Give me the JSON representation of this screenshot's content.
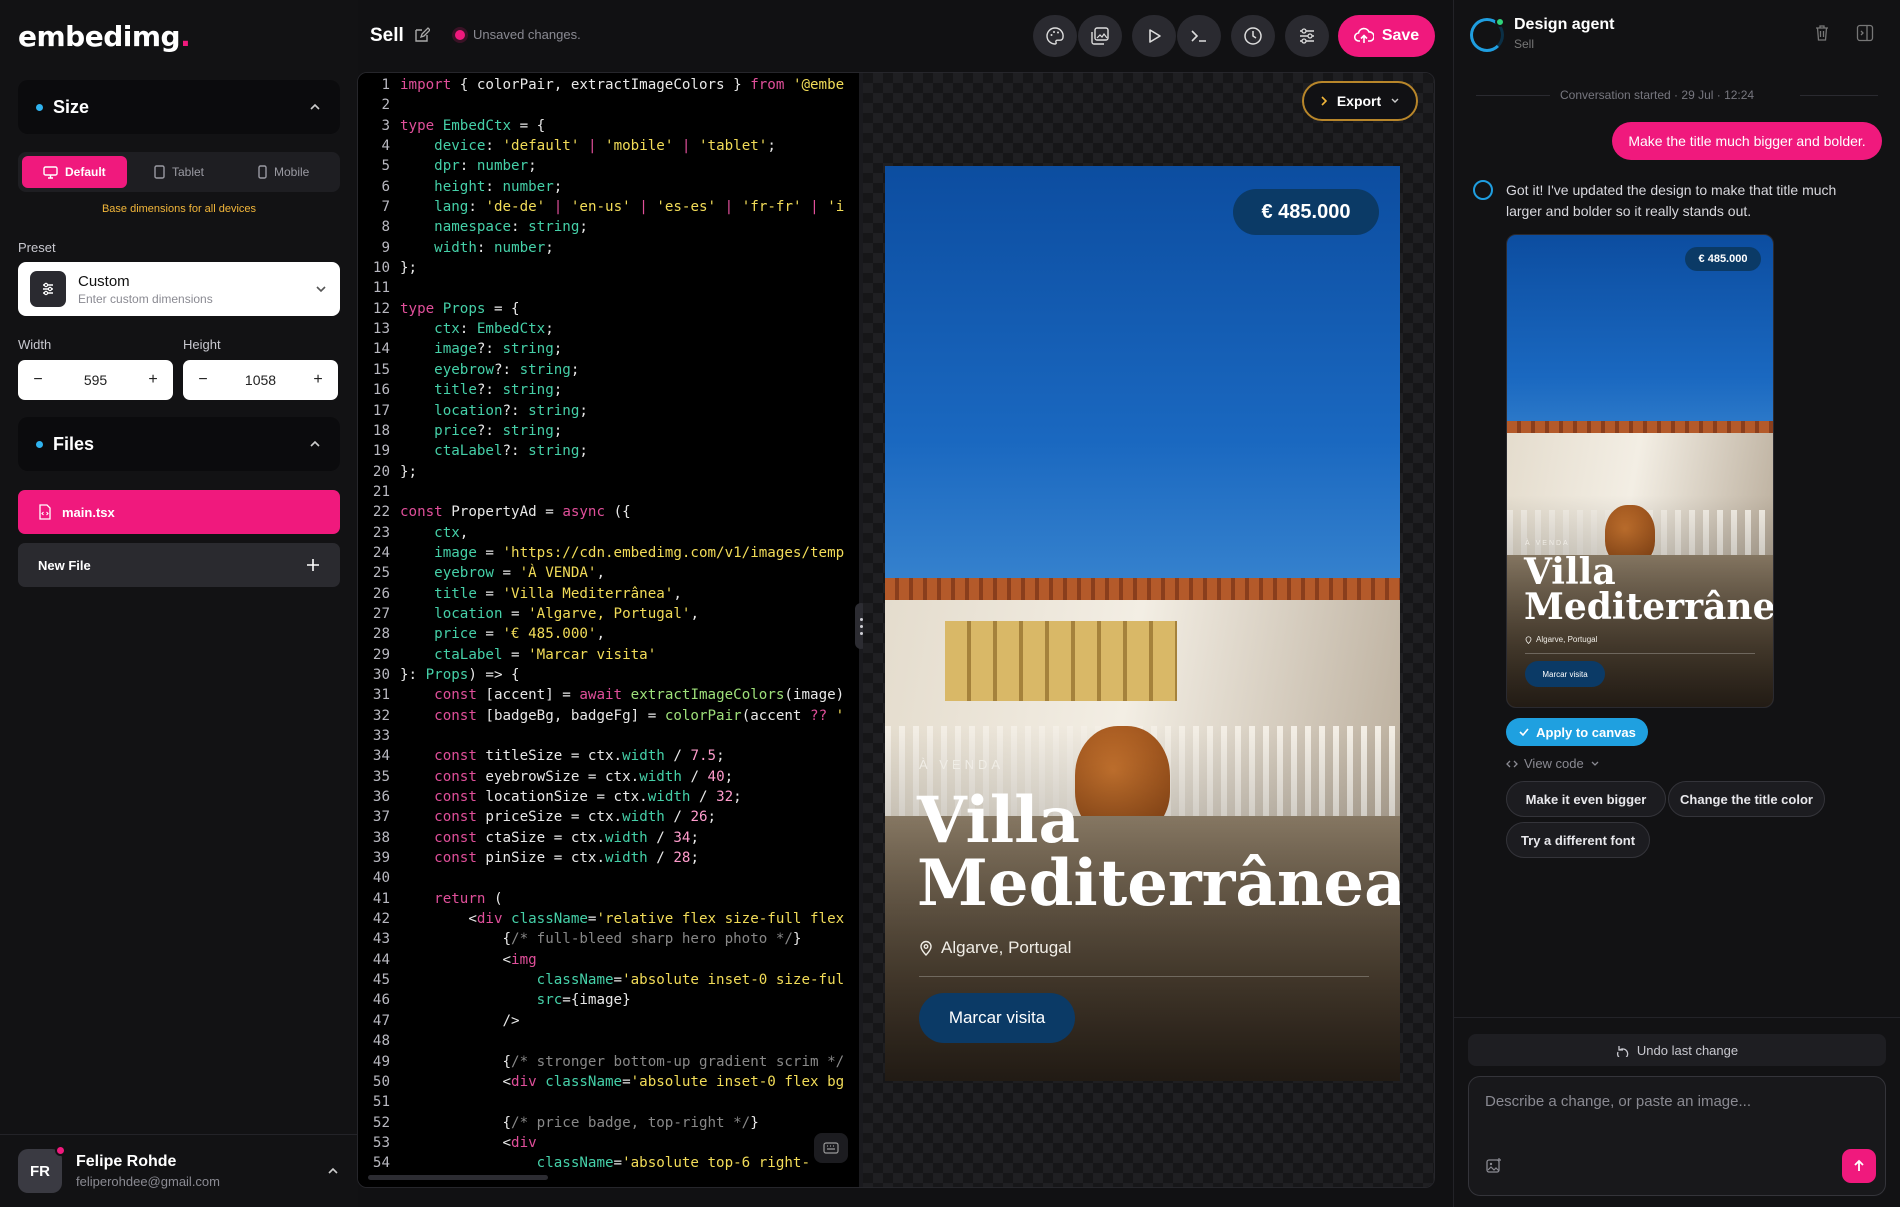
{
  "app": {
    "logo_text": "embedimg",
    "logo_dot": "."
  },
  "size_panel": {
    "title": "Size",
    "devices": [
      {
        "label": "Default",
        "icon": "monitor-icon",
        "active": true
      },
      {
        "label": "Tablet",
        "icon": "tablet-icon",
        "active": false
      },
      {
        "label": "Mobile",
        "icon": "mobile-icon",
        "active": false
      }
    ],
    "hint": "Base dimensions for all devices",
    "preset_label": "Preset",
    "preset_value": "Custom",
    "preset_sub": "Enter custom dimensions",
    "width_label": "Width",
    "width_value": "595",
    "height_label": "Height",
    "height_value": "1058"
  },
  "files_panel": {
    "title": "Files",
    "active_file": "main.tsx",
    "new_file": "New File"
  },
  "user": {
    "initials": "FR",
    "name": "Felipe Rohde",
    "email": "feliperohdee@gmail.com"
  },
  "topbar": {
    "doc_title": "Sell",
    "status": "Unsaved changes.",
    "save_label": "Save",
    "tools": [
      "palette-icon",
      "images-icon",
      "play-icon",
      "terminal-icon",
      "history-icon",
      "sliders-icon"
    ]
  },
  "editor": {
    "lines": [
      {
        "n": "1",
        "html": "<span class=\"tk\">import</span> { colorPair, extractImageColors } <span class=\"tk\">from</span> <span class=\"st\">'@embe</span>"
      },
      {
        "n": "2",
        "html": ""
      },
      {
        "n": "3",
        "html": "<span class=\"tk\">type</span> <span class=\"ty\">EmbedCtx</span> = {"
      },
      {
        "n": "4",
        "html": "    <span class=\"ty\">device</span>: <span class=\"st\">'default'</span> <span class=\"tk\">|</span> <span class=\"st\">'mobile'</span> <span class=\"tk\">|</span> <span class=\"st\">'tablet'</span>;"
      },
      {
        "n": "5",
        "html": "    <span class=\"ty\">dpr</span>: <span class=\"ty\">number</span>;"
      },
      {
        "n": "6",
        "html": "    <span class=\"ty\">height</span>: <span class=\"ty\">number</span>;"
      },
      {
        "n": "7",
        "html": "    <span class=\"ty\">lang</span>: <span class=\"st\">'de-de'</span> <span class=\"tk\">|</span> <span class=\"st\">'en-us'</span> <span class=\"tk\">|</span> <span class=\"st\">'es-es'</span> <span class=\"tk\">|</span> <span class=\"st\">'fr-fr'</span> <span class=\"tk\">|</span> <span class=\"st\">'i</span>"
      },
      {
        "n": "8",
        "html": "    <span class=\"ty\">namespace</span>: <span class=\"ty\">string</span>;"
      },
      {
        "n": "9",
        "html": "    <span class=\"ty\">width</span>: <span class=\"ty\">number</span>;"
      },
      {
        "n": "10",
        "html": "};"
      },
      {
        "n": "11",
        "html": ""
      },
      {
        "n": "12",
        "html": "<span class=\"tk\">type</span> <span class=\"ty\">Props</span> = {"
      },
      {
        "n": "13",
        "html": "    <span class=\"ty\">ctx</span>: <span class=\"ty\">EmbedCtx</span>;"
      },
      {
        "n": "14",
        "html": "    <span class=\"ty\">image</span>?: <span class=\"ty\">string</span>;"
      },
      {
        "n": "15",
        "html": "    <span class=\"ty\">eyebrow</span>?: <span class=\"ty\">string</span>;"
      },
      {
        "n": "16",
        "html": "    <span class=\"ty\">title</span>?: <span class=\"ty\">string</span>;"
      },
      {
        "n": "17",
        "html": "    <span class=\"ty\">location</span>?: <span class=\"ty\">string</span>;"
      },
      {
        "n": "18",
        "html": "    <span class=\"ty\">price</span>?: <span class=\"ty\">string</span>;"
      },
      {
        "n": "19",
        "html": "    <span class=\"ty\">ctaLabel</span>?: <span class=\"ty\">string</span>;"
      },
      {
        "n": "20",
        "html": "};"
      },
      {
        "n": "21",
        "html": ""
      },
      {
        "n": "22",
        "html": "<span class=\"tk\">const</span> PropertyAd = <span class=\"tk\">async</span> ({"
      },
      {
        "n": "23",
        "html": "    <span class=\"ty\">ctx</span>,"
      },
      {
        "n": "24",
        "html": "    <span class=\"ty\">image</span> = <span class=\"st\">'https://cdn.embedimg.com/v1/images/temp</span>"
      },
      {
        "n": "25",
        "html": "    <span class=\"ty\">eyebrow</span> = <span class=\"st\">'À VENDA'</span>,"
      },
      {
        "n": "26",
        "html": "    <span class=\"ty\">title</span> = <span class=\"st\">'Villa Mediterrânea'</span>,"
      },
      {
        "n": "27",
        "html": "    <span class=\"ty\">location</span> = <span class=\"st\">'Algarve, Portugal'</span>,"
      },
      {
        "n": "28",
        "html": "    <span class=\"ty\">price</span> = <span class=\"st\">'€ 485.000'</span>,"
      },
      {
        "n": "29",
        "html": "    <span class=\"ty\">ctaLabel</span> = <span class=\"st\">'Marcar visita'</span>"
      },
      {
        "n": "30",
        "html": "}: <span class=\"ty\">Props</span>) => {"
      },
      {
        "n": "31",
        "html": "    <span class=\"tk\">const</span> [accent] = <span class=\"tk\">await</span> <span class=\"fn\">extractImageColors</span>(image)"
      },
      {
        "n": "32",
        "html": "    <span class=\"tk\">const</span> [badgeBg, badgeFg] = <span class=\"fn\">colorPair</span>(accent <span class=\"tk\">??</span> <span class=\"st\">'</span>"
      },
      {
        "n": "33",
        "html": ""
      },
      {
        "n": "34",
        "html": "    <span class=\"tk\">const</span> titleSize = ctx.<span class=\"ty\">width</span> / <span class=\"nm\">7.5</span>;"
      },
      {
        "n": "35",
        "html": "    <span class=\"tk\">const</span> eyebrowSize = ctx.<span class=\"ty\">width</span> / <span class=\"nm\">40</span>;"
      },
      {
        "n": "36",
        "html": "    <span class=\"tk\">const</span> locationSize = ctx.<span class=\"ty\">width</span> / <span class=\"nm\">32</span>;"
      },
      {
        "n": "37",
        "html": "    <span class=\"tk\">const</span> priceSize = ctx.<span class=\"ty\">width</span> / <span class=\"nm\">26</span>;"
      },
      {
        "n": "38",
        "html": "    <span class=\"tk\">const</span> ctaSize = ctx.<span class=\"ty\">width</span> / <span class=\"nm\">34</span>;"
      },
      {
        "n": "39",
        "html": "    <span class=\"tk\">const</span> pinSize = ctx.<span class=\"ty\">width</span> / <span class=\"nm\">28</span>;"
      },
      {
        "n": "40",
        "html": ""
      },
      {
        "n": "41",
        "html": "    <span class=\"tk\">return</span> ("
      },
      {
        "n": "42",
        "html": "        <<span class=\"tg\">div</span> <span class=\"ty\">className</span>=<span class=\"st\">'relative flex size-full flex</span>"
      },
      {
        "n": "43",
        "html": "            {<span class=\"cm\">/* full-bleed sharp hero photo */</span>}"
      },
      {
        "n": "44",
        "html": "            <<span class=\"tg\">img</span>"
      },
      {
        "n": "45",
        "html": "                <span class=\"ty\">className</span>=<span class=\"st\">'absolute inset-0 size-ful</span>"
      },
      {
        "n": "46",
        "html": "                <span class=\"ty\">src</span>={image}"
      },
      {
        "n": "47",
        "html": "            />"
      },
      {
        "n": "48",
        "html": ""
      },
      {
        "n": "49",
        "html": "            {<span class=\"cm\">/* stronger bottom-up gradient scrim */</span>"
      },
      {
        "n": "50",
        "html": "            <<span class=\"tg\">div</span> <span class=\"ty\">className</span>=<span class=\"st\">'absolute inset-0 flex bg</span>"
      },
      {
        "n": "51",
        "html": ""
      },
      {
        "n": "52",
        "html": "            {<span class=\"cm\">/* price badge, top-right */</span>}"
      },
      {
        "n": "53",
        "html": "            <<span class=\"tg\">div</span>"
      },
      {
        "n": "54",
        "html": "                <span class=\"ty\">className</span>=<span class=\"st\">'absolute top-6 right-</span>"
      }
    ]
  },
  "canvas": {
    "export_label": "Export"
  },
  "property": {
    "price": "€ 485.000",
    "eyebrow": "À VENDA",
    "title_line1": "Villa",
    "title_line2": "Mediterrânea",
    "location": "Algarve, Portugal",
    "cta": "Marcar visita"
  },
  "chat": {
    "agent_name": "Design agent",
    "agent_sub": "Sell",
    "conversation_started": "Conversation started · 29 Jul · 12:24",
    "user_message": "Make the title much bigger and bolder.",
    "agent_message": "Got it! I've updated the design to make that title much larger and bolder so it really stands out.",
    "apply_label": "Apply to canvas",
    "view_code": "View code",
    "suggestions": [
      "Make it even bigger",
      "Change the title color",
      "Try a different font"
    ],
    "undo_label": "Undo last change",
    "input_placeholder": "Describe a change, or paste an image..."
  }
}
